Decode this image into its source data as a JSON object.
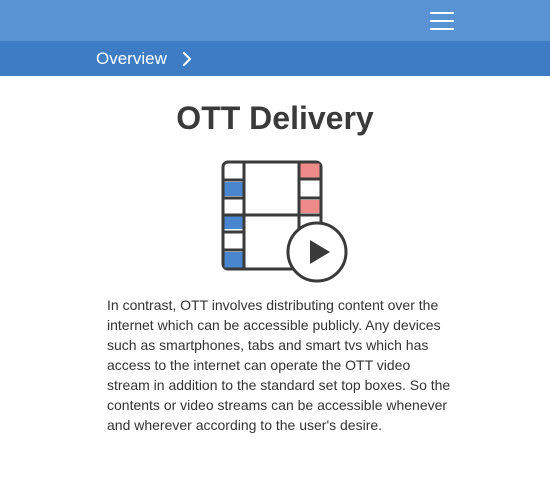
{
  "header": {
    "menu_icon": "hamburger-menu-icon"
  },
  "breadcrumb": {
    "label": "Overview",
    "chevron_icon": "chevron-right-icon"
  },
  "main": {
    "title": "OTT Delivery",
    "illustration_icon": "film-strip-play-icon",
    "paragraph": "In contrast, OTT involves distributing content over the internet which can be accessible publicly. Any devices such as smartphones, tabs and smart tvs which has access to the internet can operate the OTT video stream in addition to the standard set top boxes. So the contents or video streams can be accessible whenever and wherever according to the user's desire."
  },
  "colors": {
    "header_bg": "#5a93d4",
    "breadcrumb_bg": "#3e7cc3",
    "accent_blue": "#4a86cf",
    "accent_red": "#ef8a8a",
    "outline": "#3a3a3a"
  }
}
